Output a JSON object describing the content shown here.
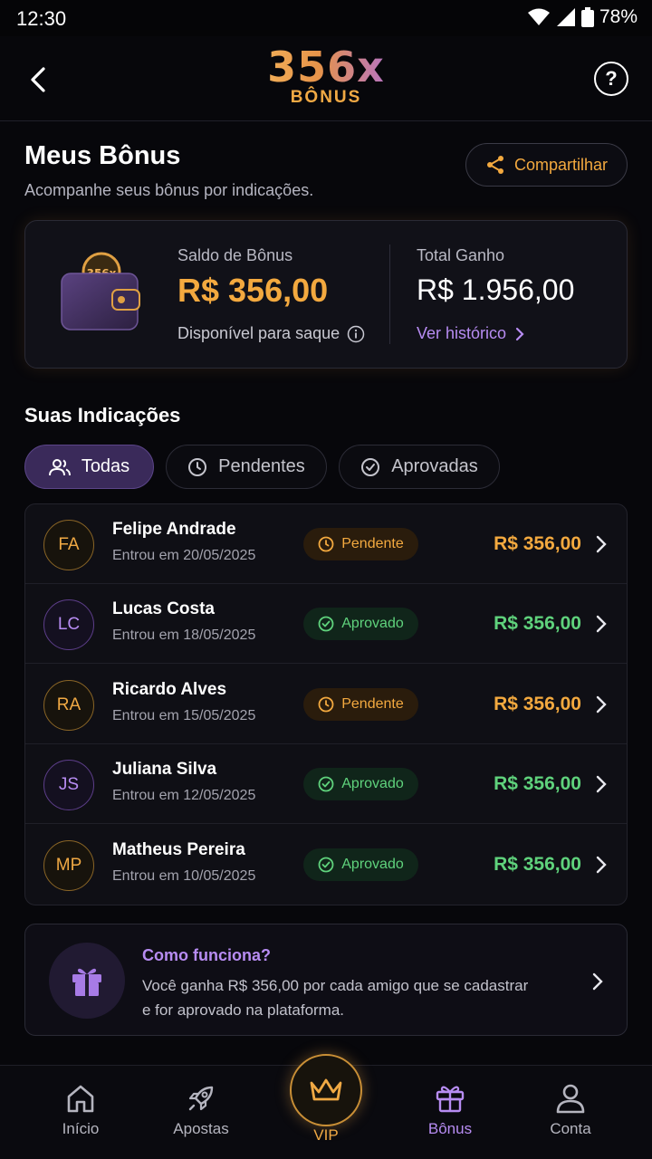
{
  "status_bar": {
    "time": "12:30",
    "battery": "78%"
  },
  "header": {
    "logo_main": "356x",
    "logo_sub": "BÔNUS"
  },
  "page": {
    "title": "Meus Bônus",
    "subtitle": "Acompanhe seus bônus por indicações.",
    "share_label": "Compartilhar"
  },
  "balance": {
    "label": "Saldo de Bônus",
    "value": "R$ 356,00",
    "note": "Disponível para saque",
    "total_label": "Total Ganho",
    "total_value": "R$ 1.956,00",
    "history_label": "Ver histórico",
    "wallet_badge": "356x"
  },
  "referrals": {
    "title": "Suas Indicações",
    "filters": [
      {
        "label": "Todas",
        "active": true
      },
      {
        "label": "Pendentes",
        "active": false
      },
      {
        "label": "Aprovadas",
        "active": false
      }
    ],
    "items": [
      {
        "initials": "FA",
        "name": "Felipe Andrade",
        "date": "Entrou em 20/05/2025",
        "status": "Pendente",
        "amount": "R$ 356,00"
      },
      {
        "initials": "LC",
        "name": "Lucas Costa",
        "date": "Entrou em 18/05/2025",
        "status": "Aprovado",
        "amount": "R$ 356,00"
      },
      {
        "initials": "RA",
        "name": "Ricardo Alves",
        "date": "Entrou em 15/05/2025",
        "status": "Pendente",
        "amount": "R$ 356,00"
      },
      {
        "initials": "JS",
        "name": "Juliana Silva",
        "date": "Entrou em 12/05/2025",
        "status": "Aprovado",
        "amount": "R$ 356,00"
      },
      {
        "initials": "MP",
        "name": "Matheus Pereira",
        "date": "Entrou em 10/05/2025",
        "status": "Aprovado",
        "amount": "R$ 356,00"
      }
    ]
  },
  "how_it_works": {
    "title": "Como funciona?",
    "text": "Você ganha R$ 356,00 por cada amigo que se cadastrar e for aprovado na plataforma."
  },
  "bottom_nav": {
    "items": [
      {
        "label": "Início",
        "icon": "home-icon"
      },
      {
        "label": "Apostas",
        "icon": "rocket-icon"
      },
      {
        "label": "VIP",
        "icon": "crown-icon"
      },
      {
        "label": "Bônus",
        "icon": "gift-icon",
        "active": true
      },
      {
        "label": "Conta",
        "icon": "user-icon"
      }
    ]
  },
  "colors": {
    "accent_gold": "#f3a93f",
    "accent_purple": "#b78cf2",
    "approved_green": "#5fd27c",
    "background": "#07070b"
  }
}
